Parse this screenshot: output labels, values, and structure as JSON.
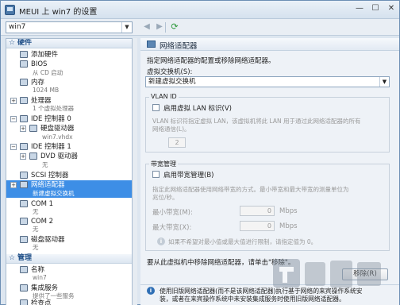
{
  "window": {
    "title": "MEUI 上 win7 的设置",
    "min_glyph": "—",
    "max_glyph": "☐",
    "close_glyph": "✕"
  },
  "toolbar": {
    "vm_selected": "win7",
    "back_glyph": "◀",
    "forward_glyph": "▶",
    "refresh_glyph": "⟳",
    "dropdown_glyph": "▼"
  },
  "sidebar": {
    "hardware_header": "硬件",
    "management_header": "管理",
    "items": [
      {
        "label": "添加硬件",
        "sub": ""
      },
      {
        "label": "BIOS",
        "sub": "从 CD 启动"
      },
      {
        "label": "内存",
        "sub": "1024 MB"
      },
      {
        "label": "处理器",
        "sub": "1 个虚拟处理器"
      },
      {
        "label": "IDE 控制器 0",
        "sub": ""
      },
      {
        "label": "硬盘驱动器",
        "sub": "win7.vhdx"
      },
      {
        "label": "IDE 控制器 1",
        "sub": ""
      },
      {
        "label": "DVD 驱动器",
        "sub": "无"
      },
      {
        "label": "SCSI 控制器",
        "sub": ""
      },
      {
        "label": "网络适配器",
        "sub": "新建虚拟交换机"
      },
      {
        "label": "COM 1",
        "sub": "无"
      },
      {
        "label": "COM 2",
        "sub": "无"
      },
      {
        "label": "磁盘驱动器",
        "sub": "无"
      },
      {
        "label": "名称",
        "sub": "win7"
      },
      {
        "label": "集成服务",
        "sub": "提供了一些服务"
      },
      {
        "label": "检查点",
        "sub": ""
      }
    ]
  },
  "panel": {
    "title": "网络适配器",
    "desc": "指定网络适配器的配置或移除网络适配器。",
    "switch_label": "虚拟交换机(S):",
    "switch_value": "新建虚拟交换机",
    "vlan": {
      "group": "VLAN ID",
      "checkbox": "启用虚拟 LAN 标识(V)",
      "desc_line1": "VLAN 标识符指定虚拟 LAN，该虚拟机将此 LAN 用于通过此网络适配器的所有",
      "desc_line2": "网络通信(L)。",
      "value": "2"
    },
    "bandwidth": {
      "group": "带宽管理",
      "checkbox": "启用带宽管理(B)",
      "desc_line1": "指定此网络适配器使用网络带宽的方式。最小带宽和最大带宽的测量单位为",
      "desc_line2": "兆位/秒。",
      "min_label": "最小带宽(M):",
      "min_value": "0",
      "max_label": "最大带宽(X):",
      "max_value": "0",
      "unit": "Mbps",
      "note": "如果不希望对最小值或最大值进行限制，请指定值为 0。"
    },
    "remove_hint": "要从此虚拟机中移除网络适配器，请单击\"移除\"。",
    "remove_button": "移除(R)",
    "footer_line1": "使用旧版网络适配器(而不是该网络适配器)执行基于网络的来宾操作系统安",
    "footer_line2": "装，或者在来宾操作系统中未安装集成服务时使用旧版网络适配器。"
  }
}
